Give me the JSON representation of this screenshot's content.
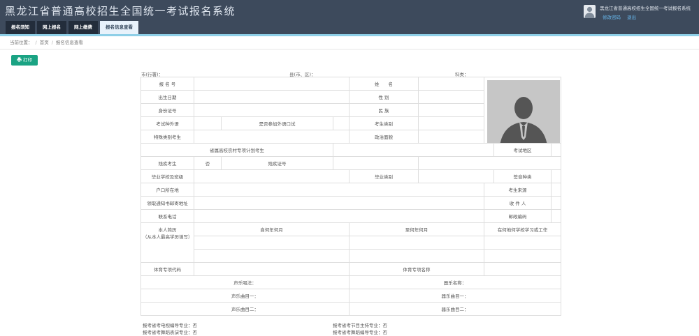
{
  "header": {
    "title": "黑龙江省普通高校招生全国统一考试报名系统",
    "user_name": "黑龙江省普通高校招生全国统一考试报名系统",
    "links": [
      "修改密码",
      "退出"
    ]
  },
  "tabs": [
    {
      "label": "报名须知",
      "active": false
    },
    {
      "label": "网上报名",
      "active": false
    },
    {
      "label": "网上缴费",
      "active": false
    },
    {
      "label": "报名信息查看",
      "active": true
    }
  ],
  "breadcrumb": {
    "prefix": "当前位置：",
    "sep": "/",
    "items": [
      "首页",
      "报名信息查看"
    ]
  },
  "print_button": "打印",
  "form_header": {
    "city": "市(行署)：",
    "county": "县(市、区)：",
    "subject": "科类："
  },
  "form": {
    "bmh": "报 名 号",
    "xm": "姓　　名",
    "csrq": "出生日期",
    "xb": "性 别",
    "sfzh": "身份证号",
    "mz": "民 族",
    "kswy": "考试种外语",
    "sfcjwyks": "是否参加外语口试",
    "kslb": "考生类别",
    "tslbks": "特殊类别考生",
    "zzmm": "政治面貌",
    "sxgx": "省属高校农村专项计划考生",
    "ksdq": "考试地区",
    "tyks": "残疾考生",
    "tyks_val": "否",
    "cjzh": "残疾证号",
    "byxx": "毕业学校及班级",
    "bylb": "毕业类别",
    "wylb": "签音种类",
    "hkszd": "户口所在地",
    "ksly": "考生来源",
    "tzsdz": "领取通知书邮寄地址",
    "sjr": "收 件 人",
    "lxdh": "联系电话",
    "yzbm": "邮政编码",
    "jl_label": "本人简历",
    "jl_note": "（从本人最高学历填写）",
    "jl_from": "自何年何月",
    "jl_to": "至何年何月",
    "jl_where": "在何地何学校学习或工作",
    "tyzxdm": "体育专项代码",
    "tyzxmc": "体育专项名称",
    "syff": "声乐唱法：",
    "qymc": "器乐名称：",
    "syqm1": "声乐曲目一：",
    "qyqm1": "器乐曲目一：",
    "syqm2": "声乐曲目二：",
    "qyqm2": "器乐曲目二："
  },
  "footer": {
    "dsbd": "报考省考电视编导专业：否",
    "jczc": "报考省考节目主持专业：否",
    "wdby": "报考省考舞蹈表演专业：否",
    "wdbd": "报考省考舞蹈编导专业：否"
  }
}
